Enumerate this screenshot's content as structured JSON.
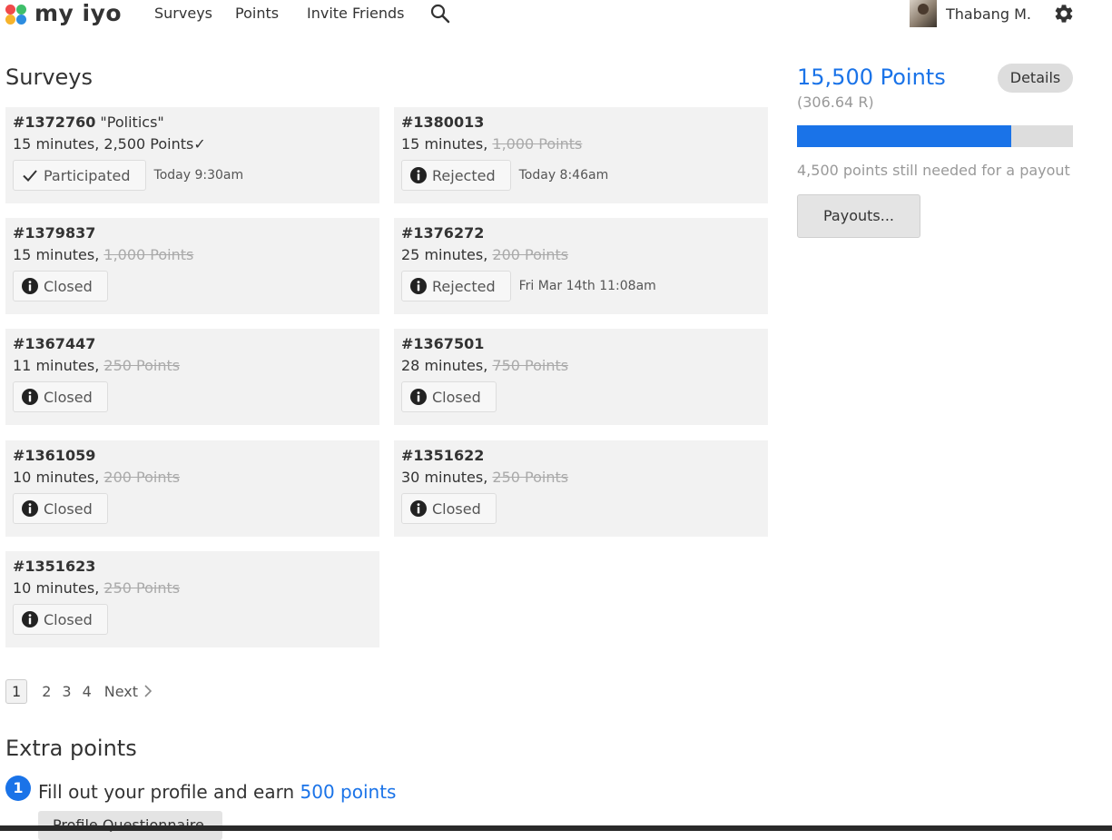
{
  "nav": {
    "brand": "my iyo",
    "links": [
      "Surveys",
      "Points",
      "Invite Friends"
    ],
    "search_icon": "search-icon",
    "user_name": "Thabang M.",
    "settings_icon": "gear-icon"
  },
  "surveys": {
    "heading": "Surveys",
    "cards": [
      {
        "id": "#1372760",
        "name": " \"Politics\"",
        "duration": "15 minutes, ",
        "points": "2,500 Points",
        "points_struck": false,
        "check": "✓",
        "status": "Participated",
        "status_icon": "checkmark-icon",
        "time": "Today 9:30am"
      },
      {
        "id": "#1380013",
        "name": "",
        "duration": "15 minutes, ",
        "points": "1,000 Points",
        "points_struck": true,
        "status": "Rejected",
        "status_icon": "info-icon",
        "time": "Today 8:46am"
      },
      {
        "id": "#1379837",
        "name": "",
        "duration": "15 minutes, ",
        "points": "1,000 Points",
        "points_struck": true,
        "status": "Closed",
        "status_icon": "info-icon",
        "time": ""
      },
      {
        "id": "#1376272",
        "name": "",
        "duration": "25 minutes, ",
        "points": "200 Points",
        "points_struck": true,
        "status": "Rejected",
        "status_icon": "info-icon",
        "time": "Fri Mar 14th 11:08am"
      },
      {
        "id": "#1367447",
        "name": "",
        "duration": "11 minutes, ",
        "points": "250 Points",
        "points_struck": true,
        "status": "Closed",
        "status_icon": "info-icon",
        "time": ""
      },
      {
        "id": "#1367501",
        "name": "",
        "duration": "28 minutes, ",
        "points": "750 Points",
        "points_struck": true,
        "status": "Closed",
        "status_icon": "info-icon",
        "time": ""
      },
      {
        "id": "#1361059",
        "name": "",
        "duration": "10 minutes, ",
        "points": "200 Points",
        "points_struck": true,
        "status": "Closed",
        "status_icon": "info-icon",
        "time": ""
      },
      {
        "id": "#1351622",
        "name": "",
        "duration": "30 minutes, ",
        "points": "250 Points",
        "points_struck": true,
        "status": "Closed",
        "status_icon": "info-icon",
        "time": ""
      },
      {
        "id": "#1351623",
        "name": "",
        "duration": "10 minutes, ",
        "points": "250 Points",
        "points_struck": true,
        "status": "Closed",
        "status_icon": "info-icon",
        "time": ""
      }
    ]
  },
  "pagination": {
    "pages": [
      "1",
      "2",
      "3",
      "4"
    ],
    "current": "1",
    "next_label": "Next"
  },
  "extra": {
    "heading": "Extra points",
    "step_number": "1",
    "step_text": "Fill out your profile and earn ",
    "step_points": "500 points",
    "profile_button": "Profile Questionnaire"
  },
  "points_panel": {
    "total": "15,500 Points",
    "value": "(306.64 R)",
    "details_label": "Details",
    "progress_fraction": 0.775,
    "payout_note": "4,500 points still needed for a payout",
    "payouts_label": "Payouts...",
    "accent_color": "#1a73e8"
  }
}
